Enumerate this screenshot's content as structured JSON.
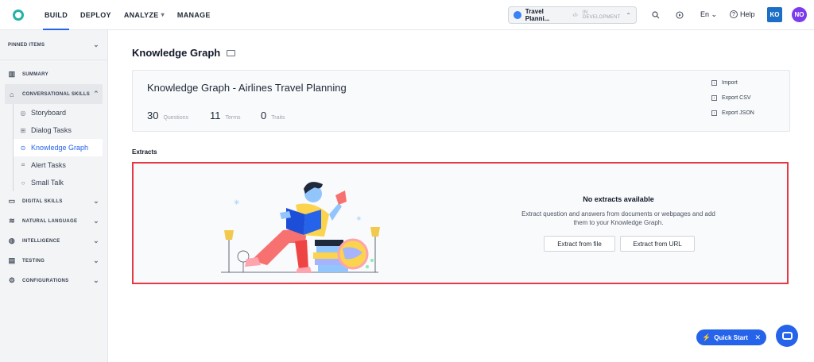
{
  "nav": {
    "tabs": [
      {
        "label": "BUILD"
      },
      {
        "label": "DEPLOY"
      },
      {
        "label": "ANALYZE",
        "chevron": "▾"
      },
      {
        "label": "MANAGE"
      }
    ],
    "bot": {
      "name": "Travel Planni...",
      "code_icon": "‹/›",
      "status": "IN DEVELOPMENT",
      "chevron": "⌃"
    },
    "language": "En ⌄",
    "help_label": "Help",
    "avatar_ko": "KO",
    "avatar_no": "NO"
  },
  "sidebar": {
    "pinned_label": "PINNED ITEMS",
    "groups_top": [
      {
        "label": "SUMMARY",
        "icon": "chart-icon"
      },
      {
        "label": "CONVERSATIONAL SKILLS",
        "icon": "chat-icon",
        "chevron": "⌃"
      }
    ],
    "sub_items": [
      {
        "label": "Storyboard",
        "icon": "storyboard-icon"
      },
      {
        "label": "Dialog Tasks",
        "icon": "dialog-icon"
      },
      {
        "label": "Knowledge Graph",
        "icon": "knowledge-icon",
        "active": true
      },
      {
        "label": "Alert Tasks",
        "icon": "alert-icon"
      },
      {
        "label": "Small Talk",
        "icon": "search-icon"
      }
    ],
    "groups_bottom": [
      {
        "label": "DIGITAL SKILLS",
        "icon": "monitor-icon"
      },
      {
        "label": "NATURAL LANGUAGE",
        "icon": "nlp-icon"
      },
      {
        "label": "INTELLIGENCE",
        "icon": "brain-icon"
      },
      {
        "label": "TESTING",
        "icon": "clipboard-icon"
      },
      {
        "label": "CONFIGURATIONS",
        "icon": "gear-icon"
      }
    ]
  },
  "page": {
    "title": "Knowledge Graph",
    "kg_name": "Knowledge Graph - Airlines Travel Planning",
    "stats": [
      {
        "value": "30",
        "label": "Questions"
      },
      {
        "value": "11",
        "label": "Terms"
      },
      {
        "value": "0",
        "label": "Traits"
      }
    ],
    "actions": [
      {
        "label": "Import"
      },
      {
        "label": "Export CSV"
      },
      {
        "label": "Export JSON"
      }
    ],
    "extracts_label": "Extracts",
    "empty_title": "No extracts available",
    "empty_desc": "Extract question and answers from documents or webpages and add them to your Knowledge Graph.",
    "btn_file": "Extract from file",
    "btn_url": "Extract from URL"
  },
  "fab": {
    "quick_start": "Quick Start"
  },
  "colors": {
    "accent": "#2563eb",
    "highlight": "#e53945",
    "brand": "#22b2a7"
  }
}
